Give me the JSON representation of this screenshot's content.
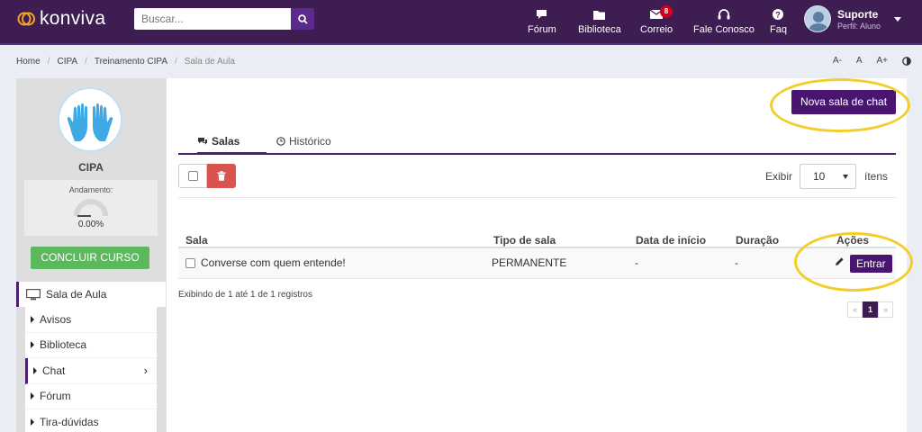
{
  "header": {
    "logo_text": "konviva",
    "search_placeholder": "Buscar...",
    "nav": [
      {
        "label": "Fórum",
        "icon": "chat-bubble-icon"
      },
      {
        "label": "Biblioteca",
        "icon": "folder-icon"
      },
      {
        "label": "Correio",
        "icon": "mail-icon",
        "badge": "8"
      },
      {
        "label": "Fale Conosco",
        "icon": "headset-icon"
      },
      {
        "label": "Faq",
        "icon": "question-circle-icon"
      }
    ],
    "user": {
      "name": "Suporte",
      "profile": "Perfil: Aluno"
    }
  },
  "breadcrumb": [
    "Home",
    "CIPA",
    "Treinamento CIPA",
    "Sala de Aula"
  ],
  "font_tools": [
    "A-",
    "A",
    "A+"
  ],
  "sidebar": {
    "course_name": "CIPA",
    "progress_label": "Andamento:",
    "progress_value": "0.00%",
    "progress_fraction": 0,
    "complete_button": "CONCLUIR CURSO",
    "section": "Sala de Aula",
    "items": [
      "Avisos",
      "Biblioteca",
      "Chat",
      "Fórum",
      "Tira-dúvidas"
    ],
    "active_item": "Chat"
  },
  "main": {
    "new_room_button": "Nova sala de chat",
    "tabs": [
      {
        "label": "Salas",
        "icon": "comments-icon"
      },
      {
        "label": "Histórico",
        "icon": "clock-icon"
      }
    ],
    "show_label": "Exibir",
    "page_size": "10",
    "items_label": "ítens",
    "columns": [
      "Sala",
      "Tipo de sala",
      "Data de início",
      "Duração",
      "Ações"
    ],
    "rows": [
      {
        "sala": "Converse com quem entende!",
        "tipo": "PERMANENTE",
        "inicio": "-",
        "duracao": "-",
        "action": "Entrar"
      }
    ],
    "records_info": "Exibindo de 1 até 1 de 1 registros",
    "pagination": {
      "prev": "«",
      "current": "1",
      "next": "»"
    }
  },
  "colors": {
    "topbar": "#3d1d52",
    "accent": "#4a1571",
    "success": "#5cb85c",
    "danger": "#d9534f",
    "highlight": "#f3cd2a"
  }
}
